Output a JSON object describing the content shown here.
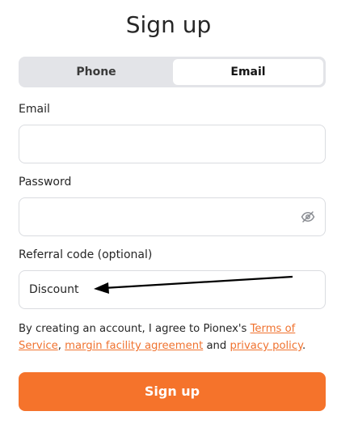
{
  "title": "Sign up",
  "tabs": [
    {
      "label": "Phone",
      "active": false
    },
    {
      "label": "Email",
      "active": true
    }
  ],
  "fields": {
    "email": {
      "label": "Email",
      "value": ""
    },
    "password": {
      "label": "Password",
      "value": "",
      "icon": "eye-slash-icon"
    },
    "referral": {
      "label": "Referral code (optional)",
      "value": "Discount"
    }
  },
  "agreement": {
    "prefix": "By creating an account, I agree to Pionex's ",
    "terms_link": "Terms of Service",
    "sep1": ", ",
    "margin_link": "margin facility agreement",
    "sep2": " and ",
    "privacy_link": "privacy policy",
    "suffix": "."
  },
  "submit_label": "Sign up",
  "colors": {
    "accent": "#f5732b",
    "link": "#f07330",
    "tab_bg": "#e3e4e8",
    "border": "#dadce0"
  }
}
